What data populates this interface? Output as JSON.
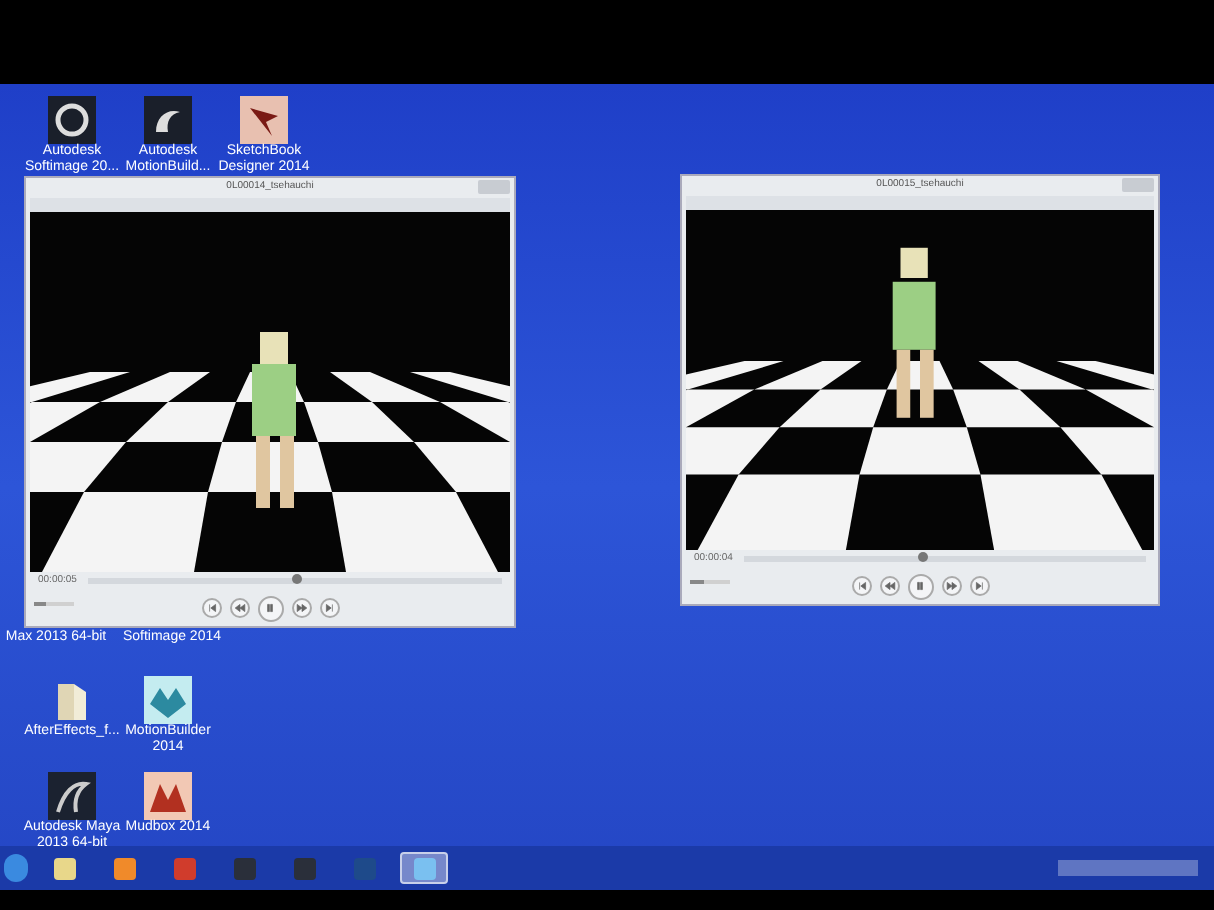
{
  "desktop_icons": [
    {
      "label": "Autodesk Softimage 20...",
      "kind": "softimage"
    },
    {
      "label": "Autodesk MotionBuild...",
      "kind": "motionbuilder"
    },
    {
      "label": "SketchBook Designer 2014",
      "kind": "sketchbook"
    },
    {
      "label": "Max 2013 64-bit",
      "kind": "covered"
    },
    {
      "label": "Softimage 2014",
      "kind": "covered"
    },
    {
      "label": "AfterEffects_f...",
      "kind": "folder"
    },
    {
      "label": "MotionBuilder 2014",
      "kind": "motionbuilder_new"
    },
    {
      "label": "Autodesk Maya 2013 64-bit",
      "kind": "maya"
    },
    {
      "label": "Mudbox 2014",
      "kind": "mudbox"
    }
  ],
  "windows": [
    {
      "title": "0L00014_tsehauchi",
      "time": "00:00:05",
      "seek": {
        "level": 0.5
      },
      "volume": {
        "level": 0.3
      }
    },
    {
      "title": "0L00015_tsehauchi",
      "time": "00:00:04",
      "seek": {
        "level": 0.44
      },
      "volume": {
        "level": 0.35
      }
    }
  ],
  "taskbar": {
    "apps": [
      {
        "kind": "explorer",
        "selected": false
      },
      {
        "kind": "media",
        "selected": false
      },
      {
        "kind": "chrome",
        "selected": false
      },
      {
        "kind": "softimage",
        "selected": false
      },
      {
        "kind": "maya",
        "selected": false
      },
      {
        "kind": "photoshop",
        "selected": false
      },
      {
        "kind": "player",
        "selected": true
      }
    ]
  }
}
